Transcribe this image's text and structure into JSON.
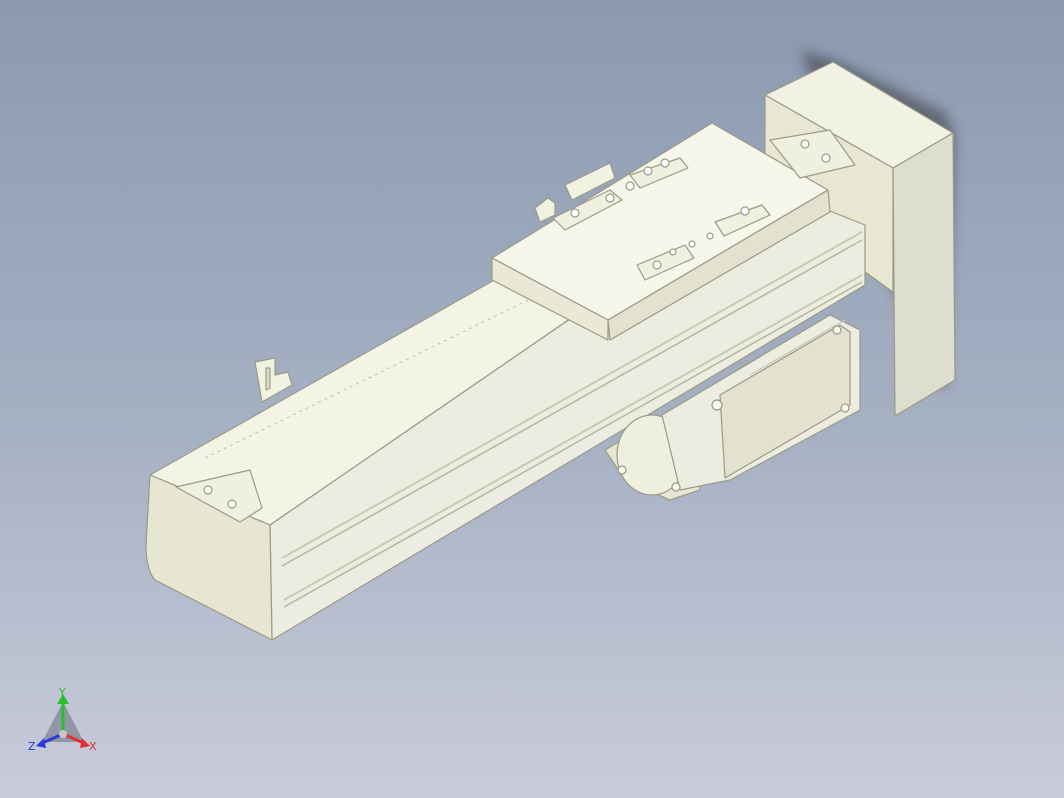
{
  "viewport": {
    "background_top": "#8b9ab0",
    "background_bottom": "#c9ccda"
  },
  "model": {
    "name": "linear-actuator-with-servo-motor",
    "part_color": "#eeeed8",
    "edge_color": "#9a9a88"
  },
  "triad": {
    "x_label": "X",
    "y_label": "Y",
    "z_label": "Z",
    "x_color": "#e23030",
    "y_color": "#28c028",
    "z_color": "#2a3bd8"
  }
}
